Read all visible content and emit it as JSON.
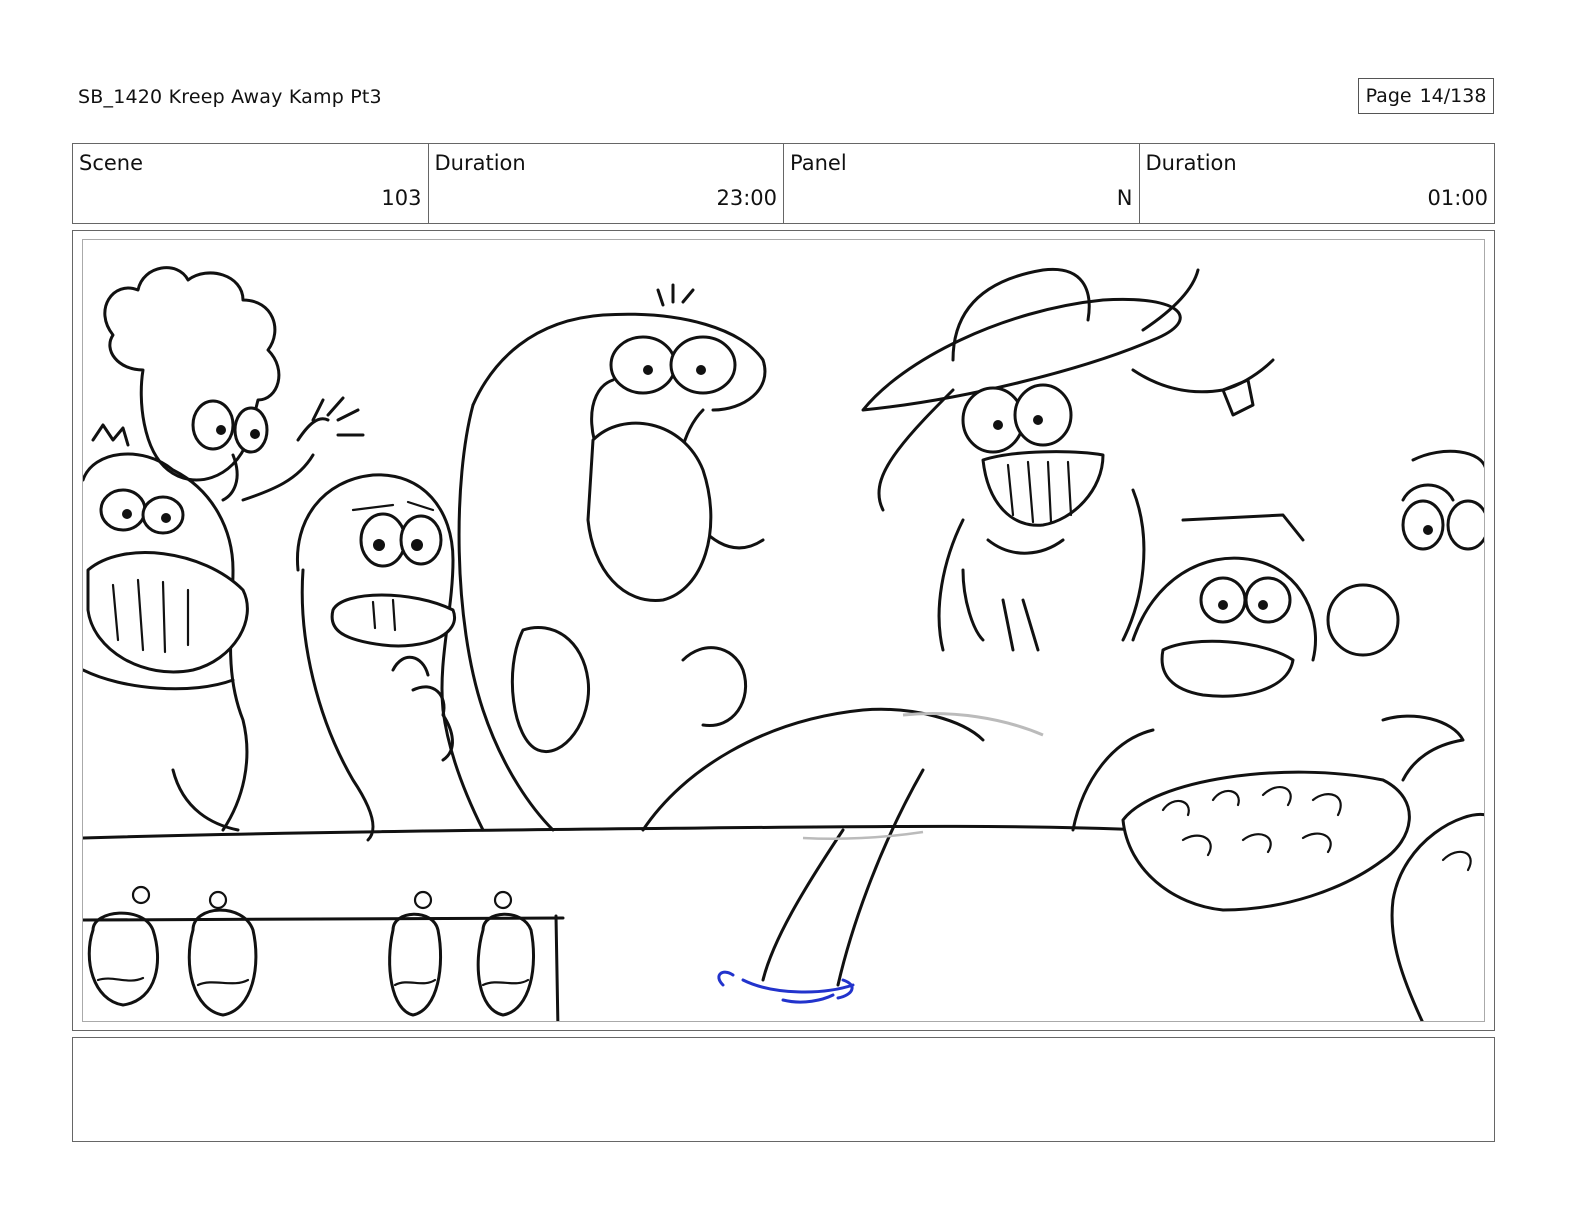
{
  "header": {
    "doc_title": "SB_1420  Kreep Away Kamp Pt3",
    "page_label": "Page",
    "page_number": "14/138"
  },
  "info": {
    "scene_label": "Scene",
    "scene_value": "103",
    "scene_duration_label": "Duration",
    "scene_duration_value": "23:00",
    "panel_label": "Panel",
    "panel_value": "N",
    "panel_duration_label": "Duration",
    "panel_duration_value": "01:00"
  },
  "notes": {
    "text": ""
  },
  "colors": {
    "ink": "#111111",
    "water_ripple": "#2233cc",
    "guide_line": "#bbbbbb",
    "frame_border": "#666666"
  }
}
